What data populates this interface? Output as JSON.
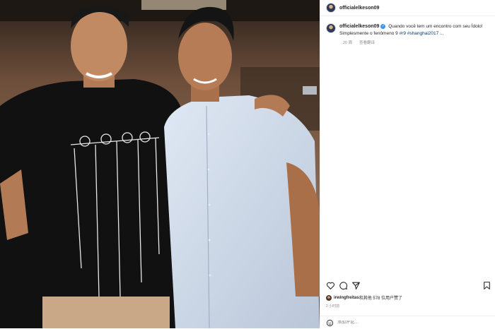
{
  "post": {
    "username": "officialelkeson09",
    "caption_text": "Quando você tem um encontro com seu Ídolo! Simplesmente o fenômeno 9",
    "caption_hashtags": "#r9 #shanghai2017 ...",
    "caption_age": "20 周",
    "translate_label": "查看翻译",
    "liked_by_user": "irwingfreitas",
    "likes_text": "和其他 578 位用户赞了",
    "time_ago": "2 小时前",
    "comment_placeholder": "添加评论..."
  },
  "icons": {
    "like": "heart-icon",
    "comment": "comment-icon",
    "share": "share-icon",
    "save": "bookmark-icon",
    "emoji": "emoji-icon"
  },
  "colors": {
    "verified": "#3897f0",
    "hashtag": "#00376b",
    "muted": "#8e8e8e"
  }
}
